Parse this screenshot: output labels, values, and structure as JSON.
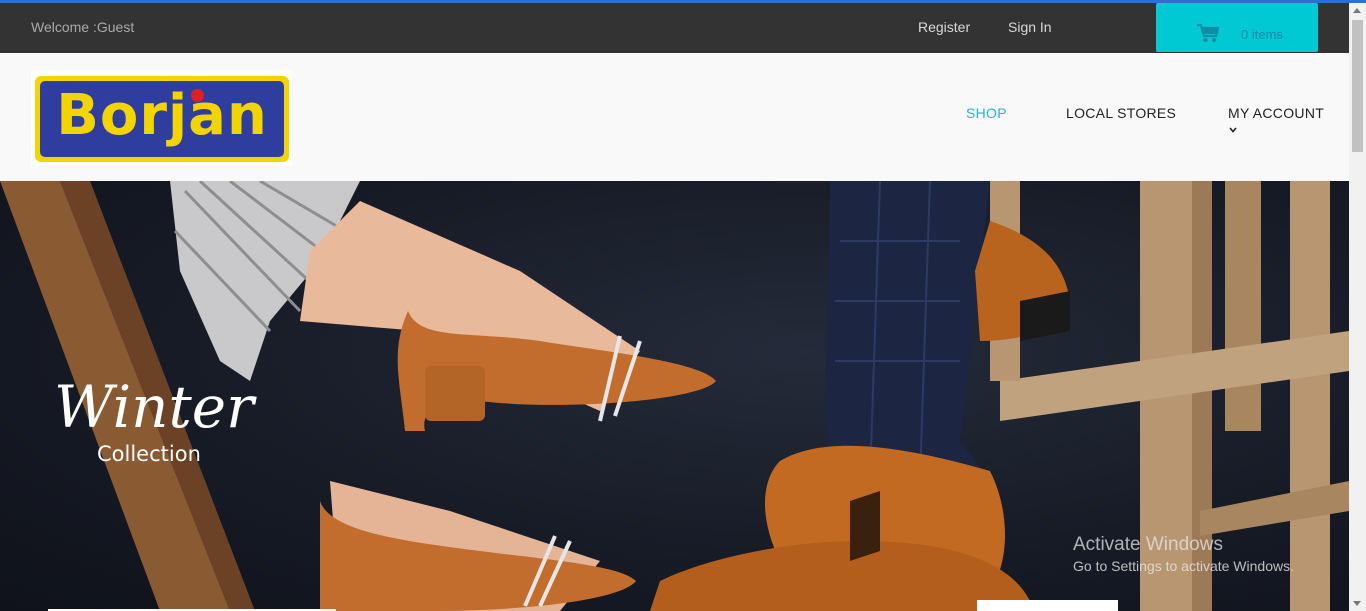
{
  "topbar": {
    "welcome": "Welcome :Guest",
    "register": "Register",
    "sign_in": "Sign In",
    "cart_count": "0 items"
  },
  "header": {
    "logo_text": "Borjan",
    "nav": {
      "shop": "SHOP",
      "local_stores": "LOCAL STORES",
      "my_account": "MY ACCOUNT"
    }
  },
  "hero": {
    "title": "Winter",
    "subtitle": "Collection"
  },
  "watermark": {
    "title": "Activate Windows",
    "subtitle": "Go to Settings to activate Windows."
  },
  "colors": {
    "accent": "#00c9d4",
    "nav_active": "#1fb8c9",
    "topbar": "#333333",
    "logo_yellow": "#f2d400",
    "logo_blue": "#2f3e9e"
  },
  "icons": {
    "cart": "cart-icon",
    "account_dropdown": "chevron-down-icon"
  }
}
